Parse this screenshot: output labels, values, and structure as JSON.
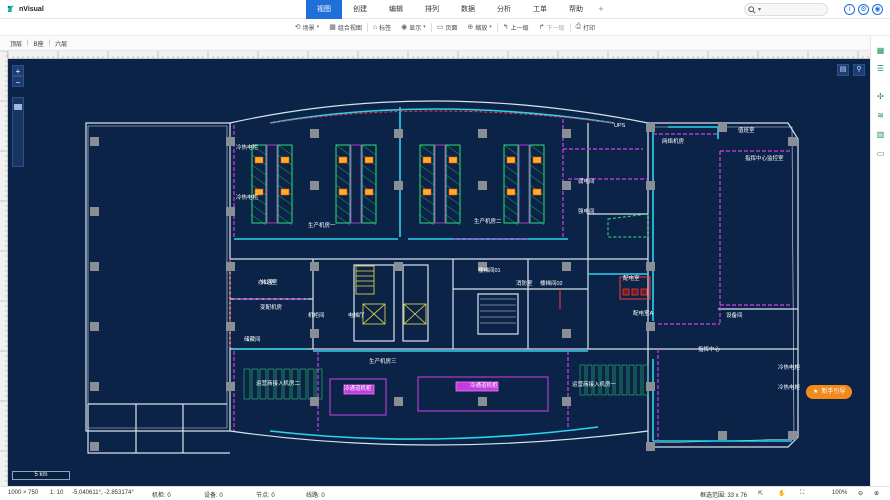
{
  "app": {
    "name": "nVisual"
  },
  "menu": {
    "items": [
      "视图",
      "创建",
      "编辑",
      "排列",
      "数据",
      "分析",
      "工单",
      "帮助"
    ],
    "active_index": 0,
    "plus": "+"
  },
  "search": {
    "placeholder": ""
  },
  "top_icons": {
    "info": "i",
    "settings": "⚙",
    "user": "◉"
  },
  "toolbar": {
    "items": [
      {
        "icon": "scene-icon",
        "label": "场景",
        "dropdown": true
      },
      {
        "icon": "combine-icon",
        "label": "组合视图",
        "dropdown": false
      },
      {
        "icon": "tag-icon",
        "label": "标签",
        "dropdown": false
      },
      {
        "icon": "display-icon",
        "label": "显示",
        "dropdown": true
      },
      {
        "icon": "page-icon",
        "label": "页面",
        "dropdown": false
      },
      {
        "icon": "zoom-icon",
        "label": "缩放",
        "dropdown": true
      },
      {
        "icon": "prev-icon",
        "label": "上一级",
        "dropdown": false
      },
      {
        "icon": "next-icon",
        "label": "下一级",
        "dropdown": false,
        "disabled": true
      },
      {
        "icon": "print-icon",
        "label": "打印",
        "dropdown": false
      }
    ]
  },
  "breadcrumb": [
    "顶层",
    "B座",
    "六层"
  ],
  "canvas": {
    "scale_label": "5 km",
    "zoom_in": "+",
    "zoom_out": "−",
    "zoom_level": 0.9,
    "guide_button": "新手引导"
  },
  "plan": {
    "labels": [
      "生产机房一",
      "生产机房二",
      "办公室",
      "楼梯间01",
      "消防室",
      "楼梯间02",
      "配电室",
      "配电室A",
      "强电间",
      "变配机房",
      "UPS",
      "设备间",
      "生产机房三",
      "运营商接入机房二",
      "冷通道机柜",
      "冷通道机柜",
      "运营商接入机房一",
      "指挥中心",
      "指挥中心监控室",
      "值班室",
      "储藏间",
      "休息室",
      "网络机房",
      "弱电间",
      "机柜间",
      "电梯厅",
      "冷热电柜",
      "冷热电柜",
      "冷热电柜",
      "冷热电柜"
    ]
  },
  "status": {
    "resolution": "1000 × 750",
    "scale": "1: 10",
    "coords": "-5.040611°, -2.853174°",
    "cabinets": "机柜: 0",
    "devices": "设备: 0",
    "nodes": "节点: 0",
    "links": "线路: 0",
    "selection": "框选范围: 33 x 76",
    "zoom": "100%"
  },
  "colors": {
    "canvas_bg": "#0b2347",
    "wall": "#d9e2ee",
    "cyan": "#2ad4f0",
    "magenta": "#d23fe6",
    "red": "#ff3b3b",
    "accent": "#1e6fd9",
    "guide": "#f28a1c"
  }
}
